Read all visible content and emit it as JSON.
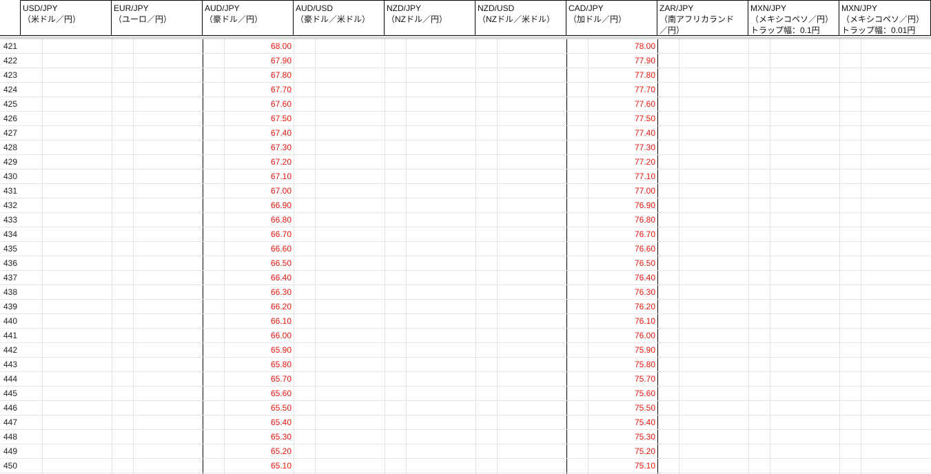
{
  "headers": [
    {
      "line1": "USD/JPY",
      "line2": "（米ドル／円）",
      "line3": ""
    },
    {
      "line1": "EUR/JPY",
      "line2": "（ユーロ／円）",
      "line3": ""
    },
    {
      "line1": "AUD/JPY",
      "line2": "（豪ドル／円）",
      "line3": ""
    },
    {
      "line1": "AUD/USD",
      "line2": "（豪ドル／米ドル）",
      "line3": ""
    },
    {
      "line1": "NZD/JPY",
      "line2": "（NZドル／円）",
      "line3": ""
    },
    {
      "line1": "NZD/USD",
      "line2": "（NZドル／米ドル）",
      "line3": ""
    },
    {
      "line1": "CAD/JPY",
      "line2": "（加ドル／円）",
      "line3": ""
    },
    {
      "line1": "ZAR/JPY",
      "line2": "（南アフリカランド",
      "line3": "／円）"
    },
    {
      "line1": "MXN/JPY",
      "line2": "（メキシコペソ／円）",
      "line3": "トラップ幅：0.1円"
    },
    {
      "line1": "MXN/JPY",
      "line2": "（メキシコペソ／円）",
      "line3": "トラップ幅：0.01円"
    }
  ],
  "rows": [
    {
      "num": "421",
      "aud_jpy": "68.00",
      "cad_jpy": "78.00"
    },
    {
      "num": "422",
      "aud_jpy": "67.90",
      "cad_jpy": "77.90"
    },
    {
      "num": "423",
      "aud_jpy": "67.80",
      "cad_jpy": "77.80"
    },
    {
      "num": "424",
      "aud_jpy": "67.70",
      "cad_jpy": "77.70"
    },
    {
      "num": "425",
      "aud_jpy": "67.60",
      "cad_jpy": "77.60"
    },
    {
      "num": "426",
      "aud_jpy": "67.50",
      "cad_jpy": "77.50"
    },
    {
      "num": "427",
      "aud_jpy": "67.40",
      "cad_jpy": "77.40"
    },
    {
      "num": "428",
      "aud_jpy": "67.30",
      "cad_jpy": "77.30"
    },
    {
      "num": "429",
      "aud_jpy": "67.20",
      "cad_jpy": "77.20"
    },
    {
      "num": "430",
      "aud_jpy": "67.10",
      "cad_jpy": "77.10"
    },
    {
      "num": "431",
      "aud_jpy": "67.00",
      "cad_jpy": "77.00"
    },
    {
      "num": "432",
      "aud_jpy": "66.90",
      "cad_jpy": "76.90"
    },
    {
      "num": "433",
      "aud_jpy": "66.80",
      "cad_jpy": "76.80"
    },
    {
      "num": "434",
      "aud_jpy": "66.70",
      "cad_jpy": "76.70"
    },
    {
      "num": "435",
      "aud_jpy": "66.60",
      "cad_jpy": "76.60"
    },
    {
      "num": "436",
      "aud_jpy": "66.50",
      "cad_jpy": "76.50"
    },
    {
      "num": "437",
      "aud_jpy": "66.40",
      "cad_jpy": "76.40"
    },
    {
      "num": "438",
      "aud_jpy": "66.30",
      "cad_jpy": "76.30"
    },
    {
      "num": "439",
      "aud_jpy": "66.20",
      "cad_jpy": "76.20"
    },
    {
      "num": "440",
      "aud_jpy": "66.10",
      "cad_jpy": "76.10"
    },
    {
      "num": "441",
      "aud_jpy": "66.00",
      "cad_jpy": "76.00"
    },
    {
      "num": "442",
      "aud_jpy": "65.90",
      "cad_jpy": "75.90"
    },
    {
      "num": "443",
      "aud_jpy": "65.80",
      "cad_jpy": "75.80"
    },
    {
      "num": "444",
      "aud_jpy": "65.70",
      "cad_jpy": "75.70"
    },
    {
      "num": "445",
      "aud_jpy": "65.60",
      "cad_jpy": "75.60"
    },
    {
      "num": "446",
      "aud_jpy": "65.50",
      "cad_jpy": "75.50"
    },
    {
      "num": "447",
      "aud_jpy": "65.40",
      "cad_jpy": "75.40"
    },
    {
      "num": "448",
      "aud_jpy": "65.30",
      "cad_jpy": "75.30"
    },
    {
      "num": "449",
      "aud_jpy": "65.20",
      "cad_jpy": "75.20"
    },
    {
      "num": "450",
      "aud_jpy": "65.10",
      "cad_jpy": "75.10"
    }
  ],
  "colors": {
    "value_text": "#e8150c",
    "grid": "#e2e2e2",
    "border": "#000000",
    "freeze_bar": "#d5d8dc"
  }
}
